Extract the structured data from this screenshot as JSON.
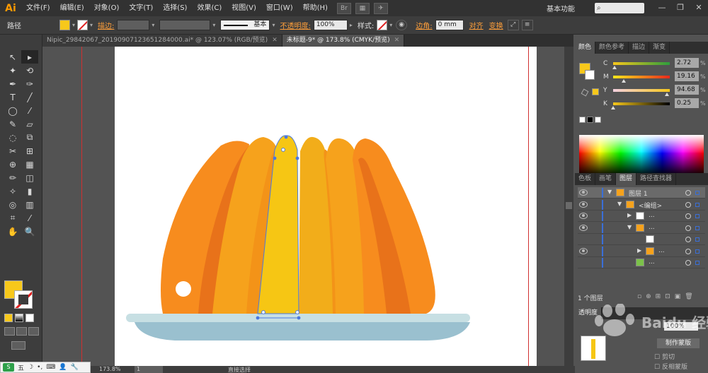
{
  "app": {
    "logo": "Ai",
    "workspace": "基本功能",
    "search_placeholder": ""
  },
  "menus": [
    "文件(F)",
    "编辑(E)",
    "对象(O)",
    "文字(T)",
    "选择(S)",
    "效果(C)",
    "视图(V)",
    "窗口(W)",
    "帮助(H)"
  ],
  "window_controls": [
    "—",
    "❐",
    "✕"
  ],
  "controlbar": {
    "selection_label": "路径",
    "stroke_label": "描边:",
    "stroke_style": "基本",
    "opacity_label": "不透明度:",
    "opacity_value": "100%",
    "style_label": "样式:",
    "corner_label": "边角:",
    "corner_value": "0 mm",
    "align_label": "对齐",
    "transform_label": "变换",
    "colors": {
      "fill": "#f7c81b",
      "accent": "#ff9f3a"
    }
  },
  "tabs": [
    {
      "label": "Nipic_29842067_20190907123651284000.ai* @ 123.07% (RGB/预览)",
      "close": "✕"
    },
    {
      "label": "未标题-9* @ 173.8% (CMYK/预览)",
      "close": "✕"
    }
  ],
  "tools": [
    "↖",
    "▸",
    "✦",
    "⟲",
    "✒",
    "✑",
    "T",
    "╱",
    "◯",
    "⁄",
    "✎",
    "▱",
    "◌",
    "⧉",
    "✂",
    "⊞",
    "⊕",
    "▦",
    "✏",
    "◫",
    "✧",
    "▮",
    "◎",
    "▥",
    "⌗",
    "⁄",
    "✋",
    "🔍"
  ],
  "color_panel": {
    "tabs": [
      "颜色",
      "颜色参考",
      "描边",
      "渐变"
    ],
    "cmyk": [
      {
        "ch": "C",
        "value": "2.72",
        "pct": "%",
        "knob": 0.03
      },
      {
        "ch": "M",
        "value": "19.16",
        "pct": "%",
        "knob": 0.19
      },
      {
        "ch": "Y",
        "value": "94.68",
        "pct": "%",
        "knob": 0.95
      },
      {
        "ch": "K",
        "value": "0.25",
        "pct": "%",
        "knob": 0.0
      }
    ]
  },
  "layers_panel": {
    "tabs": [
      "色板",
      "画笔",
      "图层",
      "路径查找器"
    ],
    "rows": [
      {
        "label": "图层 1",
        "indent": 0,
        "expand": "▼",
        "active": true
      },
      {
        "label": "<编组>",
        "indent": 1,
        "expand": "▼",
        "active": false
      },
      {
        "label": "...",
        "indent": 2,
        "expand": "▶",
        "active": false
      },
      {
        "label": "...",
        "indent": 2,
        "expand": "▼",
        "active": false
      },
      {
        "label": "",
        "indent": 3,
        "expand": "",
        "active": false
      },
      {
        "label": "...",
        "indent": 3,
        "expand": "▶",
        "active": false
      },
      {
        "label": "...",
        "indent": 2,
        "expand": "",
        "active": false
      }
    ],
    "footer": "1 个图层"
  },
  "transparency_panel": {
    "tabs": [
      "透明度"
    ],
    "opacity": "100%",
    "make_mask": "制作蒙版",
    "clip": "剪切",
    "invert": "反相蒙版"
  },
  "statusbar": {
    "zoom": "173.8%",
    "page": "1",
    "tool": "直接选择"
  },
  "ime": {
    "logo": "S",
    "mode": "五",
    "icons": [
      "☽",
      "•,",
      "⌨",
      "👤",
      "🔧"
    ]
  },
  "watermark": "Baidu 经验",
  "artwork_colors": {
    "deep_orange": "#f78c1e",
    "mid_orange": "#f6a21c",
    "yellow": "#f6c614",
    "dark_orange": "#e8721a",
    "plate": "#9ac0cf",
    "plate_rim": "#c7dfe3",
    "selection": "#4a78e0"
  }
}
